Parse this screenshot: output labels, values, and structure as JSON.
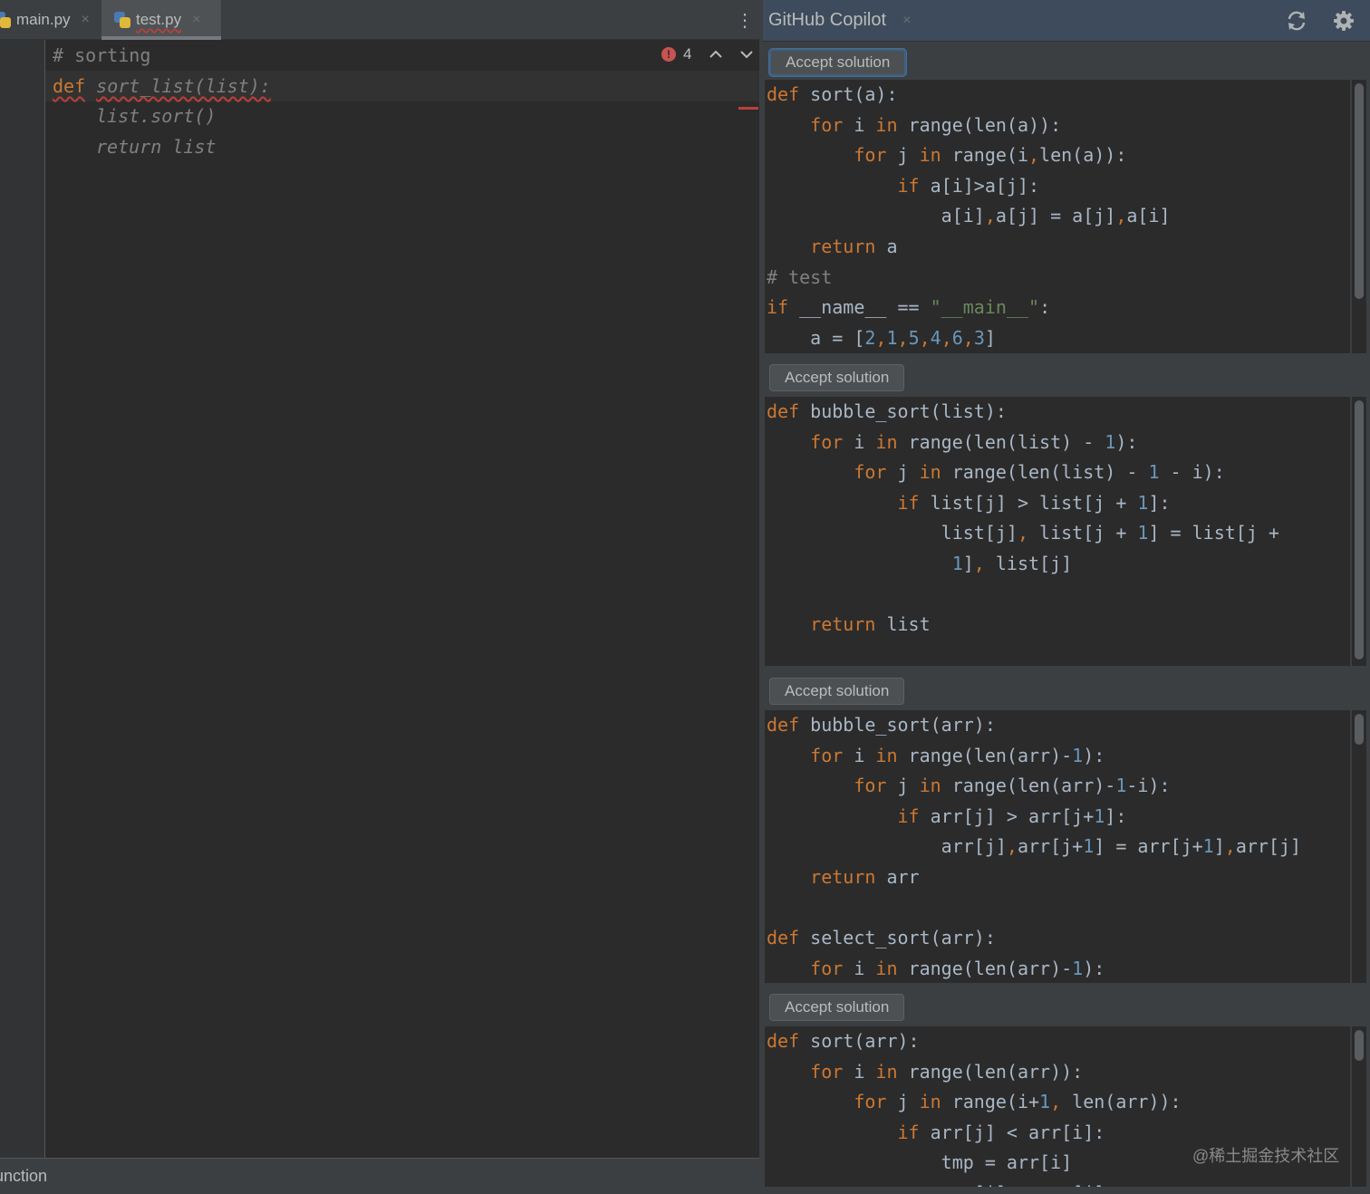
{
  "editor": {
    "tabs": [
      {
        "label": "main.py",
        "close": "×"
      },
      {
        "label": "test.py",
        "close": "×"
      }
    ],
    "tab_menu": "⋮",
    "inspection": {
      "errors": "4",
      "err_glyph": "!"
    },
    "code": {
      "comment": "# sorting",
      "def_kw": "def",
      "sig": "sort_list(list):",
      "ghost_1": "list.sort()",
      "ghost_2": "return list"
    },
    "status": {
      "text": "unction"
    }
  },
  "copilot": {
    "title": "GitHub Copilot",
    "close": "×",
    "accept_label": "Accept solution"
  },
  "watermark": "@稀土掘金技术社区"
}
